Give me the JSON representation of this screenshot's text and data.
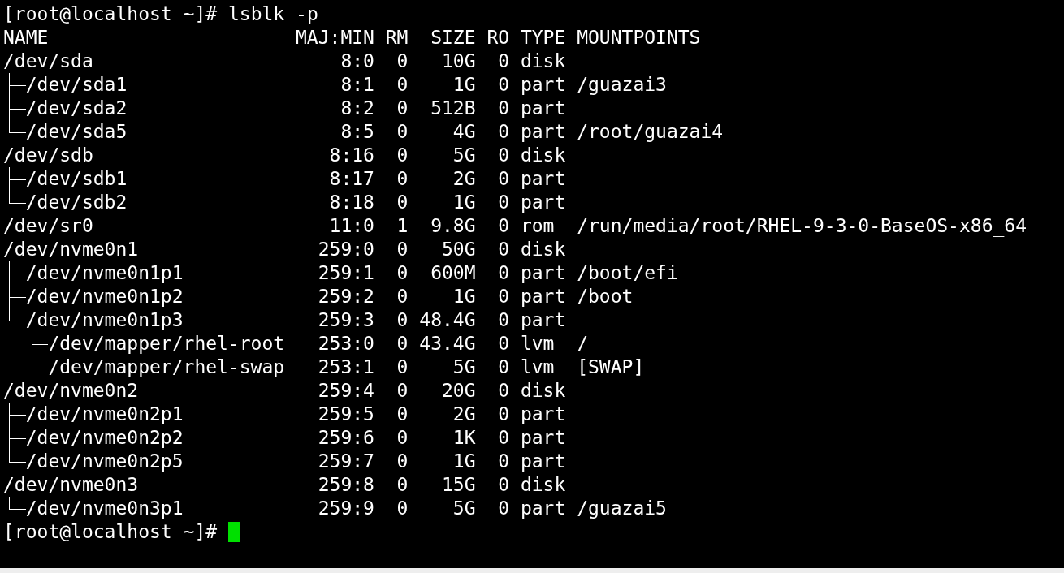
{
  "command_line": {
    "prompt": "[root@localhost ~]#",
    "command": "lsblk -p"
  },
  "table": {
    "columns": [
      "NAME",
      "MAJ:MIN",
      "RM",
      "SIZE",
      "RO",
      "TYPE",
      "MOUNTPOINTS"
    ],
    "rows": [
      {
        "name": "/dev/sda",
        "maj_min": "8:0",
        "rm": "0",
        "size": "10G",
        "ro": "0",
        "type": "disk",
        "children": [
          {
            "name": "/dev/sda1",
            "maj_min": "8:1",
            "rm": "0",
            "size": "1G",
            "ro": "0",
            "type": "part",
            "mountpoints": "/guazai3"
          },
          {
            "name": "/dev/sda2",
            "maj_min": "8:2",
            "rm": "0",
            "size": "512B",
            "ro": "0",
            "type": "part"
          },
          {
            "name": "/dev/sda5",
            "maj_min": "8:5",
            "rm": "0",
            "size": "4G",
            "ro": "0",
            "type": "part",
            "mountpoints": "/root/guazai4"
          }
        ]
      },
      {
        "name": "/dev/sdb",
        "maj_min": "8:16",
        "rm": "0",
        "size": "5G",
        "ro": "0",
        "type": "disk",
        "children": [
          {
            "name": "/dev/sdb1",
            "maj_min": "8:17",
            "rm": "0",
            "size": "2G",
            "ro": "0",
            "type": "part"
          },
          {
            "name": "/dev/sdb2",
            "maj_min": "8:18",
            "rm": "0",
            "size": "1G",
            "ro": "0",
            "type": "part"
          }
        ]
      },
      {
        "name": "/dev/sr0",
        "maj_min": "11:0",
        "rm": "1",
        "size": "9.8G",
        "ro": "0",
        "type": "rom",
        "mountpoints": "/run/media/root/RHEL-9-3-0-BaseOS-x86_64"
      },
      {
        "name": "/dev/nvme0n1",
        "maj_min": "259:0",
        "rm": "0",
        "size": "50G",
        "ro": "0",
        "type": "disk",
        "children": [
          {
            "name": "/dev/nvme0n1p1",
            "maj_min": "259:1",
            "rm": "0",
            "size": "600M",
            "ro": "0",
            "type": "part",
            "mountpoints": "/boot/efi"
          },
          {
            "name": "/dev/nvme0n1p2",
            "maj_min": "259:2",
            "rm": "0",
            "size": "1G",
            "ro": "0",
            "type": "part",
            "mountpoints": "/boot"
          },
          {
            "name": "/dev/nvme0n1p3",
            "maj_min": "259:3",
            "rm": "0",
            "size": "48.4G",
            "ro": "0",
            "type": "part",
            "children": [
              {
                "name": "/dev/mapper/rhel-root",
                "maj_min": "253:0",
                "rm": "0",
                "size": "43.4G",
                "ro": "0",
                "type": "lvm",
                "mountpoints": "/"
              },
              {
                "name": "/dev/mapper/rhel-swap",
                "maj_min": "253:1",
                "rm": "0",
                "size": "5G",
                "ro": "0",
                "type": "lvm",
                "mountpoints": "[SWAP]"
              }
            ]
          }
        ]
      },
      {
        "name": "/dev/nvme0n2",
        "maj_min": "259:4",
        "rm": "0",
        "size": "20G",
        "ro": "0",
        "type": "disk",
        "children": [
          {
            "name": "/dev/nvme0n2p1",
            "maj_min": "259:5",
            "rm": "0",
            "size": "2G",
            "ro": "0",
            "type": "part"
          },
          {
            "name": "/dev/nvme0n2p2",
            "maj_min": "259:6",
            "rm": "0",
            "size": "1K",
            "ro": "0",
            "type": "part"
          },
          {
            "name": "/dev/nvme0n2p5",
            "maj_min": "259:7",
            "rm": "0",
            "size": "1G",
            "ro": "0",
            "type": "part"
          }
        ]
      },
      {
        "name": "/dev/nvme0n3",
        "maj_min": "259:8",
        "rm": "0",
        "size": "15G",
        "ro": "0",
        "type": "disk",
        "children": [
          {
            "name": "/dev/nvme0n3p1",
            "maj_min": "259:9",
            "rm": "0",
            "size": "5G",
            "ro": "0",
            "type": "part",
            "mountpoints": "/guazai5"
          }
        ]
      }
    ]
  },
  "final_prompt": {
    "prompt": "[root@localhost ~]#"
  }
}
